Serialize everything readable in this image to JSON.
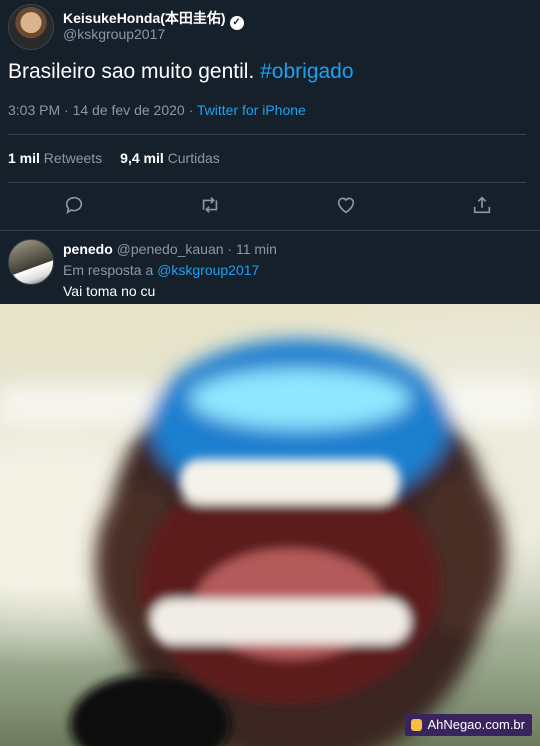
{
  "tweet": {
    "display_name": "KeisukeHonda(本田圭佑)",
    "handle": "@kskgroup2017",
    "text_plain": "Brasileiro sao muito gentil.",
    "hashtag": "#obrigado",
    "time": "3:03 PM · 14 de fev de 2020 ·",
    "source": "Twitter for iPhone",
    "retweets_count": "1 mil",
    "retweets_label": "Retweets",
    "likes_count": "9,4 mil",
    "likes_label": "Curtidas",
    "actions": [
      "reply-icon",
      "retweet-icon",
      "like-icon",
      "share-icon"
    ]
  },
  "reply": {
    "name": "penedo",
    "handle": "@penedo_kauan",
    "time": "· 11 min",
    "reply_prefix": "Em resposta a",
    "reply_to": "@kskgroup2017",
    "text": "Vai toma no cu"
  },
  "photo": {
    "subject": "blurry laughing face meme",
    "watermark": "AhNegao.com.br"
  },
  "colors": {
    "background": "#15202b",
    "accent": "#1da1f2",
    "muted": "#8899a6",
    "divider": "#38444d"
  }
}
